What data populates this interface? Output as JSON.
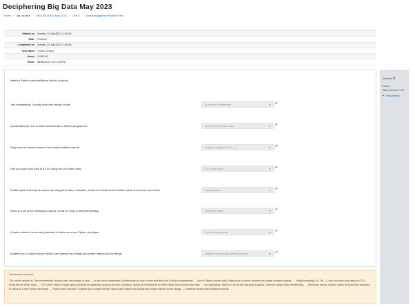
{
  "page": {
    "title": "Deciphering Big Data May 2023"
  },
  "breadcrumb": [
    {
      "label": "Home",
      "current": false
    },
    {
      "label": "My courses",
      "current": true
    },
    {
      "label": "DBD_PCOM7E May 2023",
      "current": false
    },
    {
      "label": "Unit 4",
      "current": false
    },
    {
      "label": "Data Management Pipeline Test",
      "current": false
    }
  ],
  "summary": [
    {
      "label": "Started on",
      "value": "Sunday, 23 July 2023, 2:33 AM"
    },
    {
      "label": "State",
      "value": "Finished"
    },
    {
      "label": "Completed on",
      "value": "Sunday, 23 July 2023, 2:36 AM"
    },
    {
      "label": "Time taken",
      "value": "3 mins 21 secs"
    },
    {
      "label": "Marks",
      "value": "2.00/2.00"
    },
    {
      "label": "Grade",
      "value_bold": "10.00",
      "value_rest": " out of 10.00 (100%)"
    }
  ],
  "question_info": {
    "prefix": "Question",
    "number": "1",
    "status": "Correct",
    "mark": "Mark 1.00 out of 1.00",
    "flag": "Flag question"
  },
  "question": {
    "prompt": "Match a Python concept/library with its purpose.",
    "rows": [
      {
        "stem": "Test membership. Usually used with strings or lists.",
        "answer": "In and not in statements"
      },
      {
        "stem": "A philosophy for how to write and think like a Python programmer.",
        "answer": "Zen of Python (import this)"
      },
      {
        "stem": "Flags used to format numbers into easily readable objects.",
        "answer": "String formatting (.4f, 2%,...)"
      },
      {
        "stem": "Lets you store your data in a CSV using the csv writer class.",
        "answer": "CSV writer object"
      },
      {
        "stem": "Enable quick and easy list assembly using an iterator, a function, and/or an if statement to further clean and process your data",
        "answer": "List generators"
      },
      {
        "stem": "Returns a list of the dictionary's values. Great for using to test membership.",
        "answer": "Dictionary values"
      },
      {
        "stem": "A basic outline of some best practices to follow as a new Python developer.",
        "answer": "Python best practices"
      },
      {
        "stem": "Enables you to easily format Python date objects into strings and create objects out for strings.",
        "answer": "Datetime strptime and strftime methods"
      }
    ]
  },
  "feedback": {
    "correct_msg": "Your answer is correct.",
    "answer_text": "The correct answer is: Test membership. Usually used with strings or lists. → In and not in statements, A philosophy for how to write and think like a Python programmer. → Zen of Python (import this), Flags used to format numbers into easily readable objects. → String formatting (.4f, 2%,...), Lets you store your data in a CSV using the csv writer class. → CSV writer object, Enable quick and easy list assembly using an iterator, a function, and/or an if statement to further clean and process your data. → List generators, Returns a list of the dictionary's values. Great for using to test membership. → Dictionary values, A basic outline of some best practices to follow as a new Python developer. → Python best practices, Enables you to easily format Python date objects into strings and create objects out for strings. → Datetime strptime and strftime methods"
  },
  "colors": {
    "link": "#0f6cbf",
    "correct": "#357a32",
    "feedback_bg": "#fcefdc"
  },
  "icons": {
    "caret": "caret-down-icon",
    "check": "check-icon",
    "flag": "flag-icon"
  }
}
